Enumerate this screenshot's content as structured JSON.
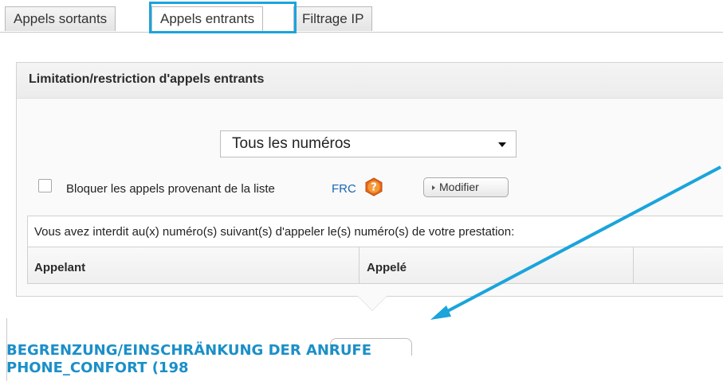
{
  "tabs": [
    {
      "label": "Appels sortants",
      "active": false
    },
    {
      "label": "Appels entrants",
      "active": true
    },
    {
      "label": "Filtrage IP",
      "active": false
    }
  ],
  "panel": {
    "title": "Limitation/restriction d'appels entrants",
    "select": {
      "value": "Tous les numéros"
    },
    "block_checkbox": {
      "label": "Bloquer les appels provenant de la liste",
      "link": "FRC",
      "checked": false
    },
    "help_icon": "question-mark-icon",
    "modify_button": "Modifier",
    "info_text": "Vous avez interdit au(x) numéro(s) suivant(s) d'appeler le(s) numéro(s) de votre prestation:",
    "table": {
      "columns": [
        "Appelant",
        "Appelé",
        ""
      ]
    }
  },
  "caption": {
    "line1": "BEGRENZUNG/EINSCHRÄNKUNG DER ANRUFE",
    "line2": "PHONE_CONFORT (198"
  },
  "colors": {
    "highlight": "#1aa4dc",
    "link": "#1a66b3",
    "caption": "#1b8fc8",
    "help_icon": "#e8681a"
  }
}
